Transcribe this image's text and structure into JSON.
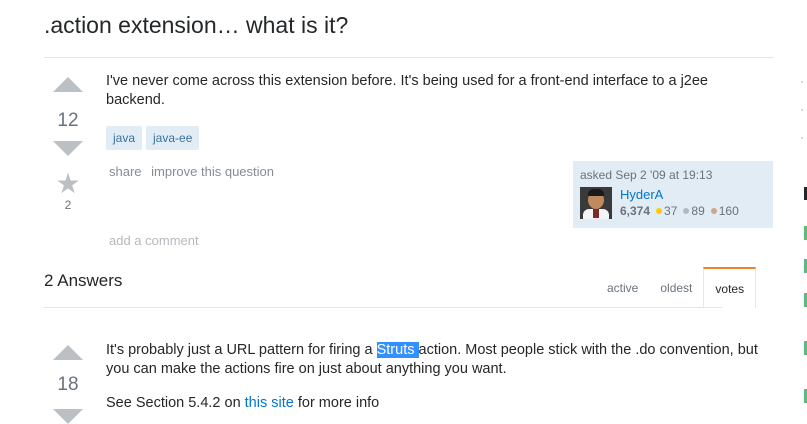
{
  "question": {
    "title": ".action extension… what is it?",
    "votes": "12",
    "favorites": "2",
    "body": "I've never come across this extension before. It's being used for a front-end interface to a j2ee backend.",
    "tags": [
      "java",
      "java-ee"
    ],
    "menu": {
      "share": "share",
      "improve": "improve this question"
    },
    "asked": {
      "time": "asked Sep 2 '09 at 19:13",
      "user": "HyderA",
      "reputation": "6,374",
      "gold": "37",
      "silver": "89",
      "bronze": "160"
    },
    "add_comment": "add a comment"
  },
  "answers": {
    "header": "2 Answers",
    "tabs": [
      "active",
      "oldest",
      "votes"
    ],
    "selected_tab": "votes",
    "first": {
      "votes": "18",
      "text_before": "It's probably just a URL pattern for firing a ",
      "highlight": "Struts ",
      "text_after": "action. Most people stick with the .do convention, but you can make the actions fire on just about anything you want.",
      "p2_before": "See Section 5.4.2 on ",
      "p2_link": "this site",
      "p2_after": " for more info"
    }
  },
  "colors": {
    "link": "#0077cc",
    "tag_bg": "#e1ecf4",
    "tag_text": "#39739d",
    "gold": "#ffcc01",
    "silver": "#b4b8bc",
    "bronze": "#d1a684",
    "active_tab": "#f48024",
    "highlight": "#3390ff"
  }
}
